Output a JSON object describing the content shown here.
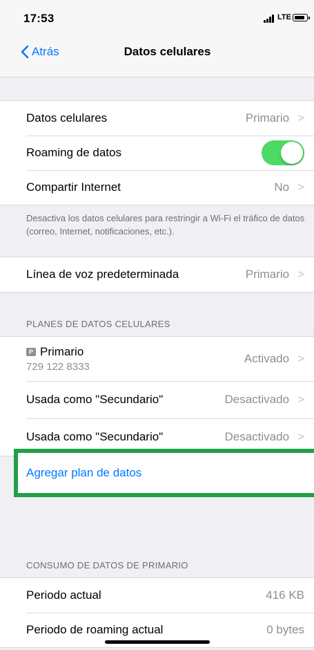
{
  "status_bar": {
    "time": "17:53",
    "network": "LTE",
    "icons": [
      "signal-icon",
      "battery-icon"
    ]
  },
  "nav": {
    "back_label": "Atrás",
    "title": "Datos celulares",
    "back_icon": "chevron-left-icon"
  },
  "group1": {
    "rows": [
      {
        "label": "Datos celulares",
        "value": "Primario"
      },
      {
        "label": "Roaming de datos",
        "toggle": true
      },
      {
        "label": "Compartir Internet",
        "value": "No"
      }
    ],
    "footnote": "Desactiva los datos celulares para restringir a Wi-Fi el tráfico de datos (correo, Internet, notificaciones, etc.)."
  },
  "group2": {
    "rows": [
      {
        "label": "Línea de voz predeterminada",
        "value": "Primario"
      }
    ]
  },
  "plans": {
    "header": "PLANES DE DATOS CELULARES",
    "primary": {
      "name": "Primario",
      "sim_badge": "P",
      "number": "729 122 8333",
      "status": "Activado"
    },
    "rows": [
      {
        "label": "Usada como \"Secundario\"",
        "value": "Desactivado"
      },
      {
        "label": "Usada como \"Secundario\"",
        "value": "Desactivado"
      }
    ],
    "add_label": "Agregar plan de datos"
  },
  "usage": {
    "header": "CONSUMO DE DATOS DE PRIMARIO",
    "rows": [
      {
        "label": "Periodo actual",
        "value": "416 KB"
      },
      {
        "label": "Periodo de roaming actual",
        "value": "0 bytes"
      }
    ]
  },
  "colors": {
    "accent": "#007aff",
    "toggle_on": "#4cd964",
    "highlight_box": "#1fa048",
    "background": "#efeff4"
  }
}
